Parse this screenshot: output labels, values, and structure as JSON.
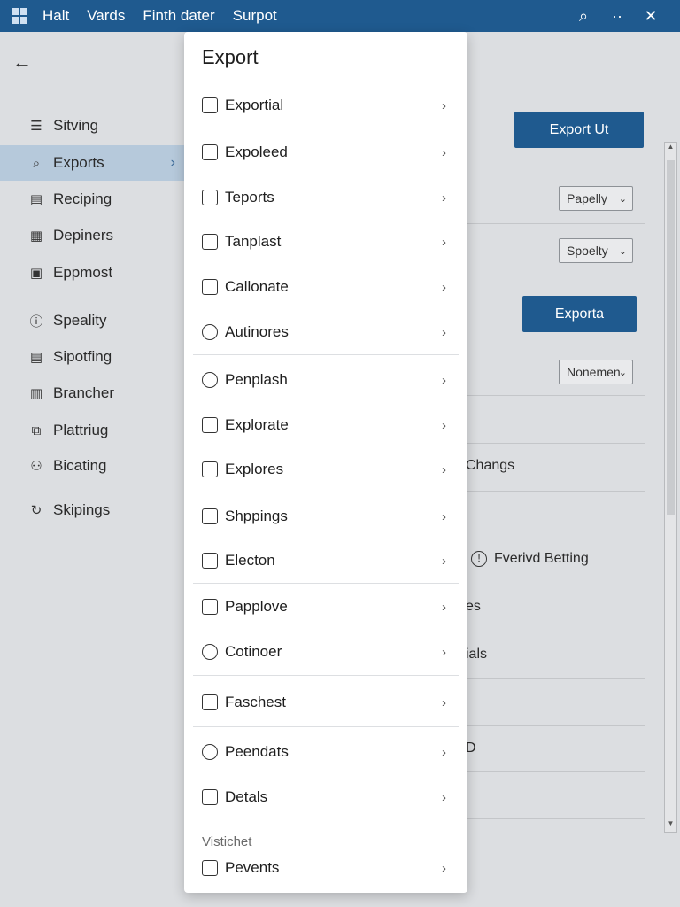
{
  "menubar": {
    "items": [
      "Halt",
      "Vards",
      "Finth dater",
      "Surpot"
    ]
  },
  "window_controls": {
    "search_icon": "search-icon",
    "more_icon": "dots-icon",
    "close_icon": "close-icon"
  },
  "sidebar": {
    "items": [
      {
        "label": "Sitving",
        "icon": "list-icon"
      },
      {
        "label": "Exports",
        "icon": "search-icon",
        "active": true
      },
      {
        "label": "Reciping",
        "icon": "doc-icon"
      },
      {
        "label": "Depiners",
        "icon": "table-icon"
      },
      {
        "label": "Eppmost",
        "icon": "box-icon"
      },
      {
        "label": "Speality",
        "icon": "info-icon"
      },
      {
        "label": "Sipotfing",
        "icon": "doc-icon"
      },
      {
        "label": "Brancher",
        "icon": "file-icon"
      },
      {
        "label": "Plattriug",
        "icon": "layers-icon"
      },
      {
        "label": "Bicating",
        "icon": "users-icon"
      },
      {
        "label": "Skipings",
        "icon": "refresh-icon"
      }
    ]
  },
  "content": {
    "export_button": "Export Ut",
    "select1": "Papelly",
    "select2": "Spoelty",
    "exporta_button": "Exporta",
    "select3": "Nonemen",
    "peek_changs": "Changs",
    "peek_betting": "Fverivd Betting",
    "peek_es": "es",
    "peek_ials": "ials",
    "peek_d": "D"
  },
  "dropdown": {
    "title": "Export",
    "items": [
      {
        "label": "Exportial",
        "icon": "export-icon"
      },
      {
        "label": "Expoleed",
        "icon": "printer-icon"
      },
      {
        "label": "Teports",
        "icon": "pages-icon"
      },
      {
        "label": "Tanplast",
        "icon": "bank-icon"
      },
      {
        "label": "Callonate",
        "icon": "transfer-icon"
      },
      {
        "label": "Autinores",
        "icon": "user-icon"
      },
      {
        "label": "Penplash",
        "icon": "link-icon"
      },
      {
        "label": "Explorate",
        "icon": "folder-icon"
      },
      {
        "label": "Explores",
        "icon": "bottle-icon"
      },
      {
        "label": "Shppings",
        "icon": "chat-icon"
      },
      {
        "label": "Electon",
        "icon": "tag-icon"
      },
      {
        "label": "Papplove",
        "icon": "copy-icon"
      },
      {
        "label": "Cotinoer",
        "icon": "person-icon"
      },
      {
        "label": "Faschest",
        "icon": "grid-icon"
      },
      {
        "label": "Peendats",
        "icon": "share-icon"
      },
      {
        "label": "Detals",
        "icon": "note-icon"
      }
    ],
    "section_label": "Vistichet",
    "footer_item": {
      "label": "Pevents",
      "icon": "card-icon"
    }
  }
}
